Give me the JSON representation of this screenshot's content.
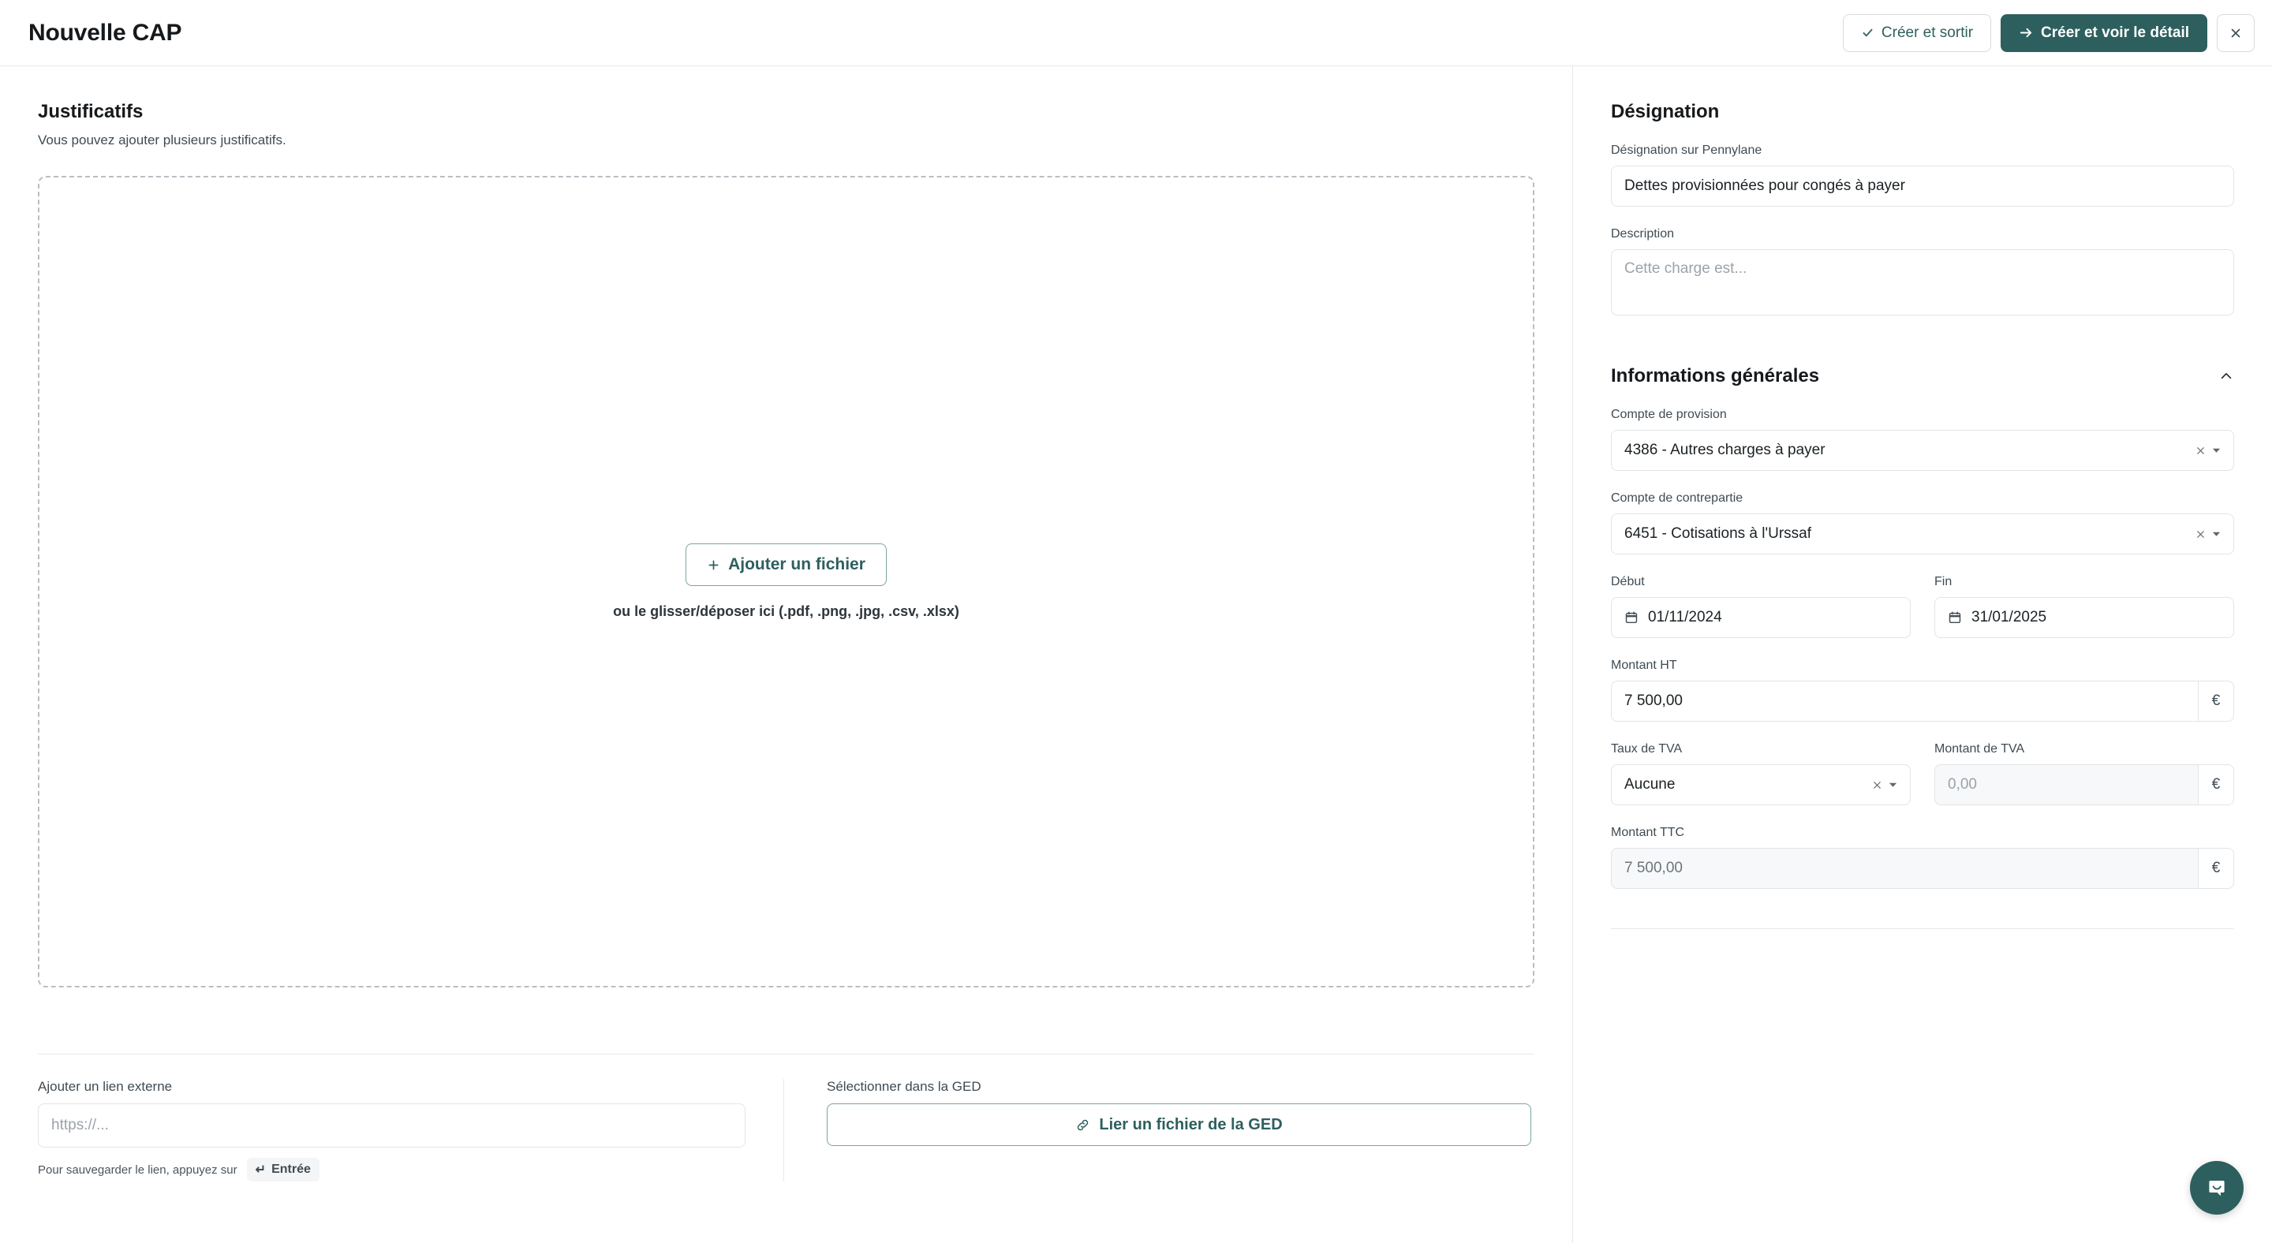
{
  "header": {
    "title": "Nouvelle CAP",
    "create_exit_label": "Créer et sortir",
    "create_detail_label": "Créer et voir le détail",
    "check_icon": "✓",
    "arrow_icon": "→",
    "close_icon": "✕"
  },
  "left": {
    "title": "Justificatifs",
    "subtitle": "Vous pouvez ajouter plusieurs justificatifs.",
    "dropzone": {
      "add_file_label": "Ajouter un fichier",
      "plus_icon": "+",
      "hint": "ou le glisser/déposer ici (.pdf, .png, .jpg, .csv, .xlsx)"
    },
    "external_link": {
      "label": "Ajouter un lien externe",
      "value": "",
      "placeholder": "https://...",
      "hint_prefix": "Pour sauvegarder le lien, appuyez sur",
      "key_label": "Entrée",
      "key_icon": "↵"
    },
    "ged": {
      "label": "Sélectionner dans la GED",
      "button_label": "Lier un fichier de la GED",
      "link_icon": "🔗"
    }
  },
  "right": {
    "designation_title": "Désignation",
    "designation_field": {
      "label": "Désignation sur Pennylane",
      "value": "Dettes provisionnées pour congés à payer",
      "placeholder": ""
    },
    "description_field": {
      "label": "Description",
      "value": "",
      "placeholder": "Cette charge est..."
    },
    "general_info": {
      "title": "Informations générales",
      "collapse_icon": "⌃",
      "expanded": true
    },
    "provision_account": {
      "label": "Compte de provision",
      "value": "4386 - Autres charges à payer",
      "clear_icon": "✕",
      "caret_icon": "▾"
    },
    "counterpart_account": {
      "label": "Compte de contrepartie",
      "value": "6451 - Cotisations à l'Urssaf",
      "clear_icon": "✕",
      "caret_icon": "▾"
    },
    "start_date": {
      "label": "Début",
      "value": "01/11/2024"
    },
    "end_date": {
      "label": "Fin",
      "value": "31/01/2025"
    },
    "amount_ht": {
      "label": "Montant HT",
      "value": "7 500,00",
      "placeholder": "",
      "currency": "€"
    },
    "vat_rate": {
      "label": "Taux de TVA",
      "value": "Aucune",
      "clear_icon": "✕",
      "caret_icon": "▾"
    },
    "vat_amount": {
      "label": "Montant de TVA",
      "value": "",
      "placeholder": "0,00",
      "currency": "€"
    },
    "amount_ttc": {
      "label": "Montant TTC",
      "value": "7 500,00",
      "placeholder": "",
      "currency": "€"
    }
  },
  "chat": {
    "icon": "chat-bubble-icon"
  },
  "colors": {
    "accent": "#2d5f5e",
    "border": "#e1e4e7",
    "text": "#1b2124",
    "muted": "#3f4b53"
  }
}
